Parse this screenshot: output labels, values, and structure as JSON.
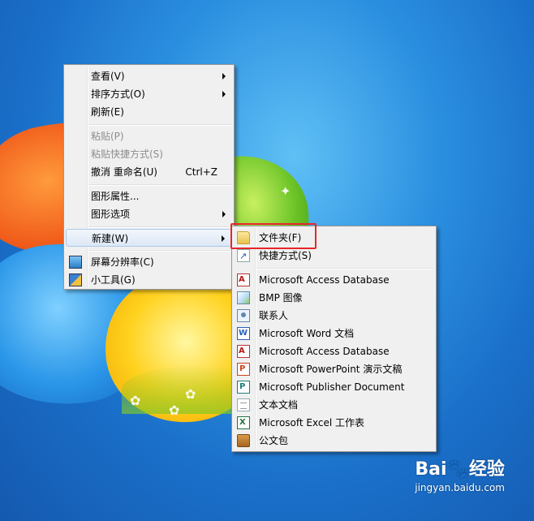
{
  "context_menu": {
    "items": [
      {
        "label": "查看(V)",
        "submenu": true,
        "disabled": false
      },
      {
        "label": "排序方式(O)",
        "submenu": true,
        "disabled": false
      },
      {
        "label": "刷新(E)",
        "submenu": false,
        "disabled": false
      },
      {
        "label": "粘贴(P)",
        "submenu": false,
        "disabled": true
      },
      {
        "label": "粘贴快捷方式(S)",
        "submenu": false,
        "disabled": true
      },
      {
        "label": "撤消 重命名(U)",
        "shortcut": "Ctrl+Z",
        "submenu": false,
        "disabled": false
      },
      {
        "label": "图形属性...",
        "submenu": false,
        "disabled": false
      },
      {
        "label": "图形选项",
        "submenu": true,
        "disabled": false
      },
      {
        "label": "新建(W)",
        "submenu": true,
        "disabled": false,
        "highlighted": true
      },
      {
        "label": "屏幕分辨率(C)",
        "icon": "monitor-icon",
        "submenu": false,
        "disabled": false
      },
      {
        "label": "小工具(G)",
        "icon": "gadget-icon",
        "submenu": false,
        "disabled": false
      }
    ]
  },
  "new_submenu": {
    "items": [
      {
        "label": "文件夹(F)",
        "icon": "folder-icon"
      },
      {
        "label": "快捷方式(S)",
        "icon": "shortcut-icon"
      },
      {
        "label": "Microsoft Access Database",
        "icon": "access-icon"
      },
      {
        "label": "BMP 图像",
        "icon": "bmp-image-icon"
      },
      {
        "label": "联系人",
        "icon": "contact-icon"
      },
      {
        "label": "Microsoft Word 文档",
        "icon": "word-icon"
      },
      {
        "label": "Microsoft Access Database",
        "icon": "access-icon"
      },
      {
        "label": "Microsoft PowerPoint 演示文稿",
        "icon": "powerpoint-icon"
      },
      {
        "label": "Microsoft Publisher Document",
        "icon": "publisher-icon"
      },
      {
        "label": "文本文档",
        "icon": "text-document-icon"
      },
      {
        "label": "Microsoft Excel 工作表",
        "icon": "excel-icon"
      },
      {
        "label": "公文包",
        "icon": "briefcase-icon"
      }
    ]
  },
  "watermark": {
    "brand": "Bai🐾经验",
    "url": "jingyan.baidu.com"
  },
  "colors": {
    "highlight_box": "#e8262a",
    "menu_background": "#f0f0f0",
    "desktop_blue": "#1f7ad0"
  }
}
